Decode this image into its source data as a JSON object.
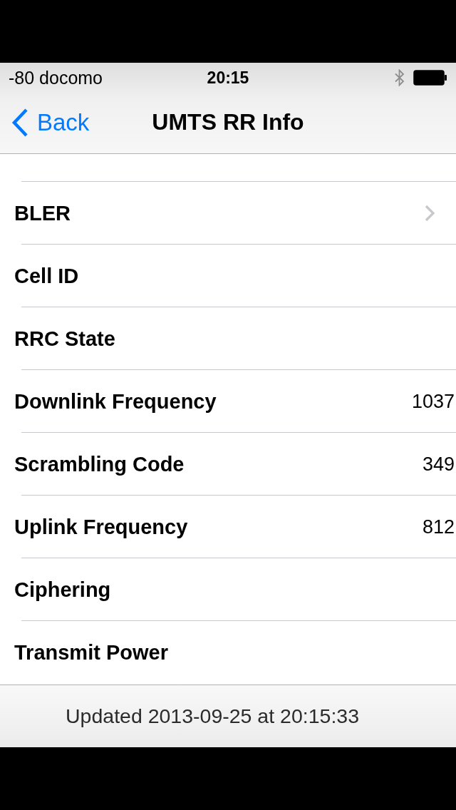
{
  "status_bar": {
    "carrier": "-80 docomo",
    "time": "20:15"
  },
  "nav_bar": {
    "back": "Back",
    "title": "UMTS RR Info"
  },
  "rows": [
    {
      "label": "BLER",
      "disclosure": true
    },
    {
      "label": "Cell ID",
      "disclosure": false
    },
    {
      "label": "RRC State",
      "disclosure": false
    },
    {
      "label": "Downlink Frequency",
      "value": "1037",
      "disclosure": false
    },
    {
      "label": "Scrambling Code",
      "value": "349",
      "disclosure": false
    },
    {
      "label": "Uplink Frequency",
      "value": "812",
      "disclosure": false
    },
    {
      "label": "Ciphering",
      "disclosure": false
    },
    {
      "label": "Transmit Power",
      "disclosure": false
    }
  ],
  "footer": {
    "text": "Updated 2013-09-25 at 20:15:33"
  }
}
